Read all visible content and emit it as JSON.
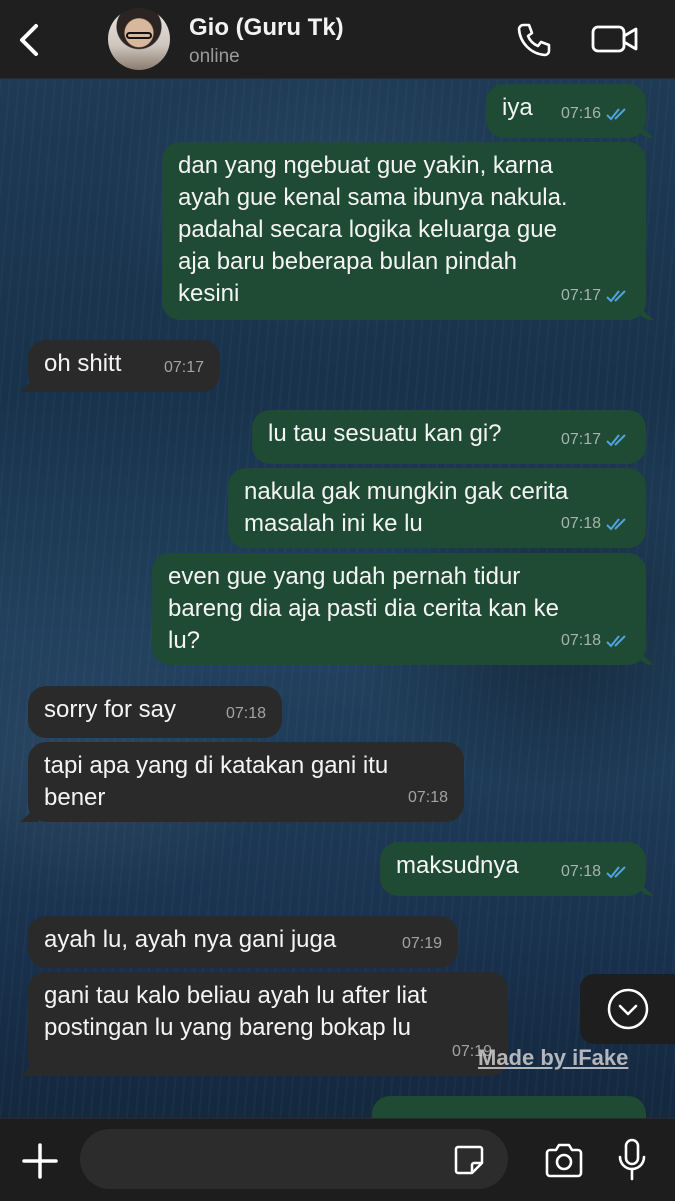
{
  "header": {
    "contact_name": "Gio (Guru Tk)",
    "contact_status": "online"
  },
  "messages": [
    {
      "dir": "out",
      "text": "iya",
      "time": "07:16",
      "read": true
    },
    {
      "dir": "out",
      "text": "dan yang ngebuat gue yakin, karna\nayah gue kenal sama ibunya nakula.\npadahal secara logika keluarga gue\naja baru beberapa bulan pindah\nkesini",
      "time": "07:17",
      "read": true
    },
    {
      "dir": "in",
      "text": "oh shitt",
      "time": "07:17"
    },
    {
      "dir": "out",
      "text": "lu tau sesuatu kan gi?",
      "time": "07:17",
      "read": true
    },
    {
      "dir": "out",
      "text": "nakula gak mungkin gak cerita\nmasalah ini ke lu",
      "time": "07:18",
      "read": true
    },
    {
      "dir": "out",
      "text": "even gue yang udah pernah tidur\nbareng dia aja pasti dia cerita kan ke\nlu?",
      "time": "07:18",
      "read": true
    },
    {
      "dir": "in",
      "text": "sorry for say",
      "time": "07:18"
    },
    {
      "dir": "in",
      "text": "tapi apa yang di katakan gani itu\nbener",
      "time": "07:18"
    },
    {
      "dir": "out",
      "text": "maksudnya",
      "time": "07:18",
      "read": true
    },
    {
      "dir": "in",
      "text": "ayah lu, ayah nya gani juga",
      "time": "07:19"
    },
    {
      "dir": "in",
      "text": "gani tau kalo beliau ayah lu after liat\npostingan lu yang bareng bokap lu",
      "time": "07:19"
    }
  ],
  "watermark": "Made by iFake",
  "icons": {
    "back": "chevron-left-icon",
    "call": "phone-icon",
    "video": "video-camera-icon",
    "scroll_down": "chevron-down-circle-icon",
    "attach": "plus-icon",
    "sticker": "sticker-icon",
    "camera": "camera-icon",
    "mic": "microphone-icon"
  },
  "colors": {
    "outgoing_bubble": "#1f4a33",
    "incoming_bubble": "#2a2a2a",
    "read_ticks": "#4fa3e0",
    "header_bg": "#1f1f1f"
  }
}
